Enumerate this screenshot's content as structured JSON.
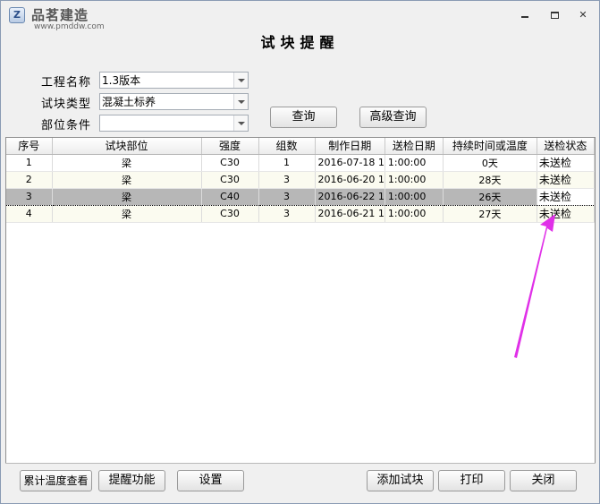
{
  "window": {
    "watermark_title": "品茗建造",
    "watermark_url": "www.pmddw.com",
    "icon_letter": "Z"
  },
  "title": "试块提醒",
  "form": {
    "project_label": "工程名称",
    "project_value": "1.3版本",
    "type_label": "试块类型",
    "type_value": "混凝土标养",
    "position_label": "部位条件",
    "position_value": "",
    "query_button": "查询",
    "advanced_query_button": "高级查询"
  },
  "table": {
    "columns": [
      "序号",
      "试块部位",
      "强度",
      "组数",
      "制作日期",
      "送检日期",
      "持续时间或温度",
      "送检状态"
    ],
    "rows": [
      [
        "1",
        "梁",
        "C30",
        "1",
        "2016-07-18 1",
        "1:00:00",
        "0天",
        "未送检"
      ],
      [
        "2",
        "梁",
        "C30",
        "3",
        "2016-06-20 1",
        "1:00:00",
        "28天",
        "未送检"
      ],
      [
        "3",
        "梁",
        "C40",
        "3",
        "2016-06-22 1",
        "1:00:00",
        "26天",
        "未送检"
      ],
      [
        "4",
        "梁",
        "C30",
        "3",
        "2016-06-21 1",
        "1:00:00",
        "27天",
        "未送检"
      ]
    ],
    "selected_row": 2
  },
  "buttons": {
    "temp_view": "累计温度查看",
    "reminder": "提醒功能",
    "settings": "设置",
    "add_block": "添加试块",
    "print": "打印",
    "close": "关闭"
  },
  "colors": {
    "annotation_arrow": "#e030e8",
    "selected_row": "#b7b7b7"
  }
}
